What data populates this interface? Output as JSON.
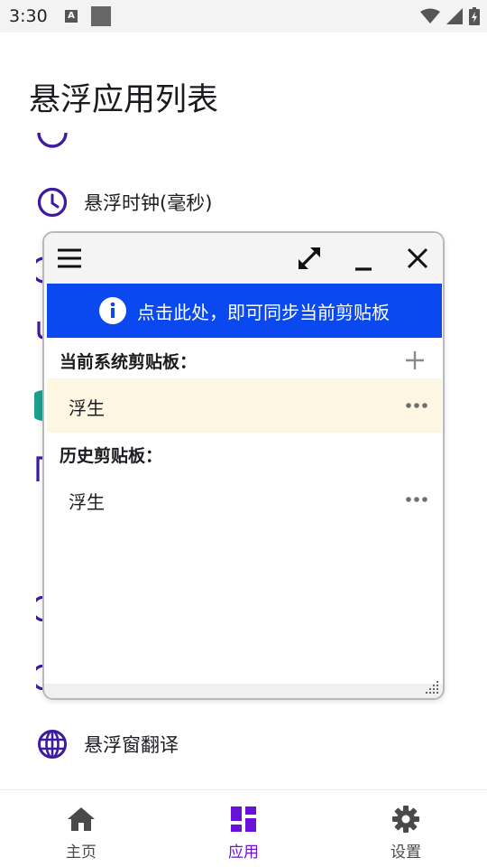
{
  "status_bar": {
    "time": "3:30",
    "notification_letter": "A"
  },
  "page": {
    "title": "悬浮应用列表"
  },
  "apps": [
    {
      "label": "悬浮时钟(毫秒)",
      "icon": "clock-icon"
    },
    {
      "label": "悬浮窗翻译",
      "icon": "globe-icon"
    }
  ],
  "float_window": {
    "sync_banner": "点击此处，即可同步当前剪贴板",
    "current_section_title": "当前系统剪贴板：",
    "current_item": "浮生",
    "history_section_title": "历史剪贴板：",
    "history_items": [
      "浮生"
    ]
  },
  "bottom_nav": {
    "items": [
      {
        "label": "主页",
        "icon": "home-icon"
      },
      {
        "label": "应用",
        "icon": "apps-icon"
      },
      {
        "label": "设置",
        "icon": "gear-icon"
      }
    ],
    "active_index": 1
  },
  "colors": {
    "accent": "#6a11d9",
    "icon_purple": "#3d1a9e",
    "banner_blue": "#0a49f0",
    "current_item_bg": "#fdf6e2"
  }
}
